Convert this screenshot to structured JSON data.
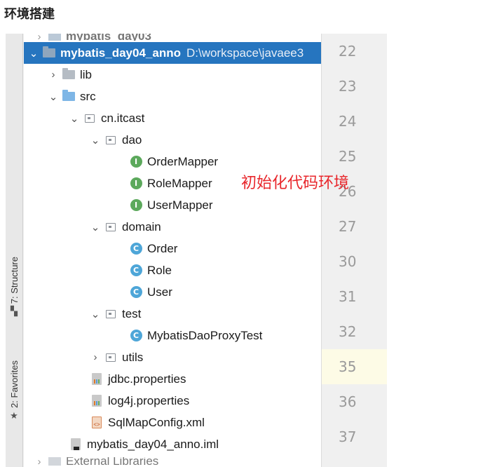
{
  "heading": "环境搭建",
  "sidebar": {
    "structure_label": "7: Structure",
    "favorites_label": "2: Favorites"
  },
  "tree": {
    "top_partial": "mybatis_day03",
    "project": {
      "name": "mybatis_day04_anno",
      "path": "D:\\workspace\\javaee3"
    },
    "items": [
      {
        "label": "lib"
      },
      {
        "label": "src"
      },
      {
        "label": "cn.itcast"
      },
      {
        "label": "dao"
      },
      {
        "label": "OrderMapper"
      },
      {
        "label": "RoleMapper"
      },
      {
        "label": "UserMapper"
      },
      {
        "label": "domain"
      },
      {
        "label": "Order"
      },
      {
        "label": "Role"
      },
      {
        "label": "User"
      },
      {
        "label": "test"
      },
      {
        "label": "MybatisDaoProxyTest"
      },
      {
        "label": "utils"
      },
      {
        "label": "jdbc.properties"
      },
      {
        "label": "log4j.properties"
      },
      {
        "label": "SqlMapConfig.xml"
      },
      {
        "label": "mybatis_day04_anno.iml"
      }
    ],
    "bottom_partial": "External Libraries"
  },
  "gutter": {
    "line_numbers": [
      "22",
      "23",
      "24",
      "25",
      "26",
      "27",
      "30",
      "31",
      "32",
      "35",
      "36",
      "37"
    ]
  },
  "annotation": "初始化代码环境",
  "colors": {
    "selection": "#2675bf",
    "annotation": "#e8262b",
    "interface_icon": "#5ca95c",
    "class_icon": "#4ea6d8"
  }
}
